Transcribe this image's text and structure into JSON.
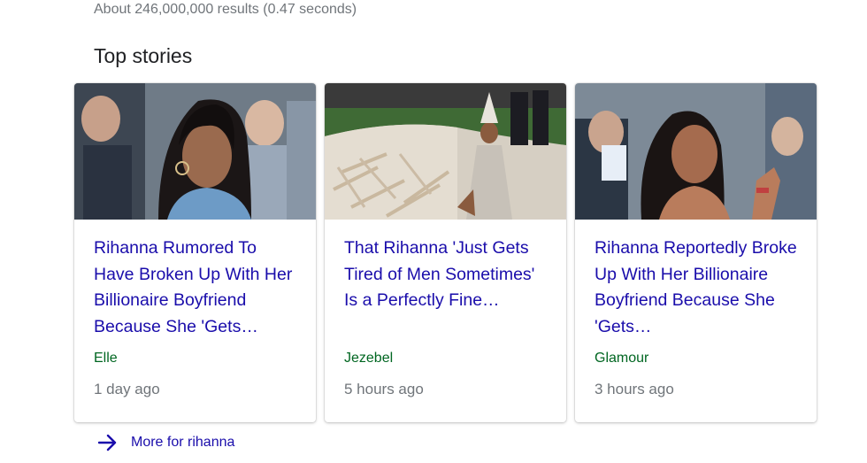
{
  "results": {
    "stats": "About 246,000,000 results (0.47 seconds)"
  },
  "top_stories": {
    "title": "Top stories",
    "cards": [
      {
        "headline": "Rihanna Rumored To Have Broken Up With Her Billionaire Boyfriend Because She 'Gets…",
        "source": "Elle",
        "age": "1 day ago"
      },
      {
        "headline": "That Rihanna 'Just Gets Tired of Men Sometimes' Is a Perfectly Fine…",
        "source": "Jezebel",
        "age": "5 hours ago"
      },
      {
        "headline": "Rihanna Reportedly Broke Up With Her Billionaire Boyfriend Because She 'Gets…",
        "source": "Glamour",
        "age": "3 hours ago"
      }
    ],
    "more": {
      "label": "More for rihanna",
      "icon": "arrow-right-icon"
    }
  },
  "colors": {
    "link": "#1a0dab",
    "source": "#006621",
    "meta": "#70757a"
  }
}
